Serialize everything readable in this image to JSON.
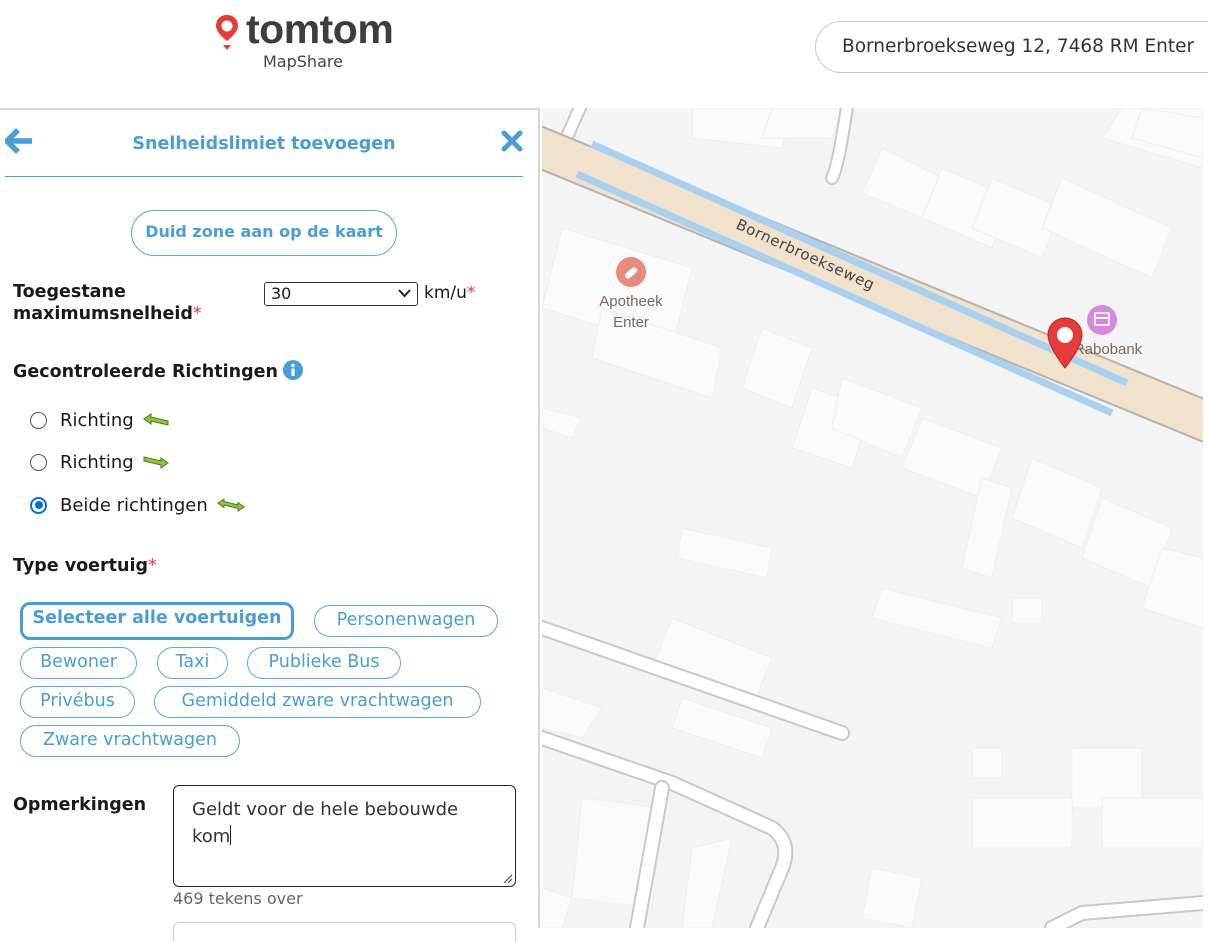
{
  "header": {
    "logo_text": "tomtom",
    "logo_subtitle": "MapShare",
    "search_value": "Bornerbroekseweg 12, 7468 RM Enter"
  },
  "panel": {
    "title": "Snelheidslimiet toevoegen",
    "zone_button": "Duid zone aan op de kaart",
    "speed_label": "Toegestane maximumsnelheid",
    "speed_value": "30",
    "speed_unit": "km/u",
    "required_mark": "*",
    "directions_label": "Gecontroleerde Richtingen",
    "directions": [
      {
        "label": "Richting",
        "selected": false,
        "arrow": "arrow-left-icon"
      },
      {
        "label": "Richting",
        "selected": false,
        "arrow": "arrow-right-icon"
      },
      {
        "label": "Beide richtingen",
        "selected": true,
        "arrow": "arrow-both-icon"
      }
    ],
    "vehicle_label": "Type voertuig",
    "vehicles": [
      "Selecteer alle voertuigen",
      "Personenwagen",
      "Bewoner",
      "Taxi",
      "Publieke Bus",
      "Privébus",
      "Gemiddeld zware vrachtwagen",
      "Zware vrachtwagen"
    ],
    "remarks_label": "Opmerkingen",
    "remarks_value": "Geldt voor de hele bebouwde kom",
    "chars_left": "469 tekens over"
  },
  "map": {
    "street_label": "Bornerbroekseweg",
    "poi_pharmacy": "Apotheek Enter",
    "poi_bank": "Rabobank"
  },
  "colors": {
    "accent": "#4a9ed6",
    "required": "#e53b3b",
    "pin": "#e53b3b",
    "road_fill": "#f0e2cc",
    "road_edge": "#a8d0f0",
    "direction_arrow": "#8cc63f"
  }
}
